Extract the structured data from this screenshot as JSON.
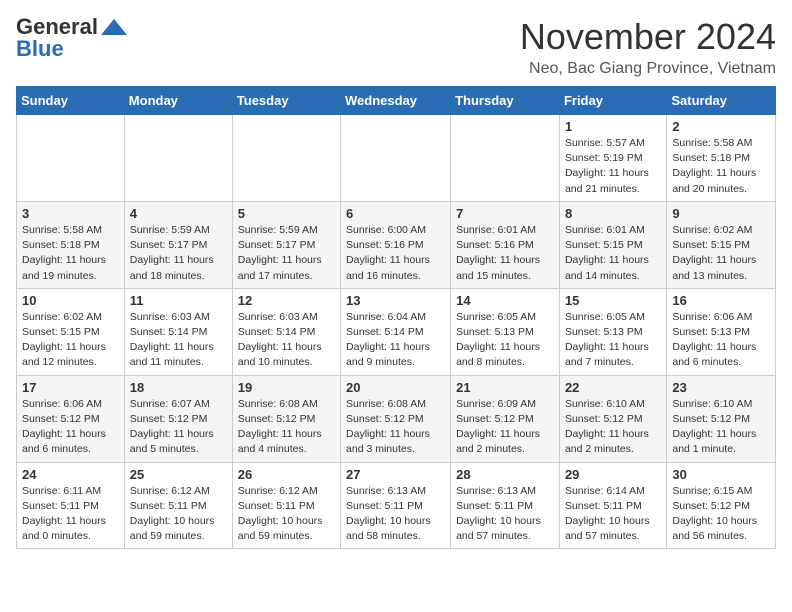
{
  "logo": {
    "general": "General",
    "blue": "Blue"
  },
  "header": {
    "month_year": "November 2024",
    "location": "Neo, Bac Giang Province, Vietnam"
  },
  "weekdays": [
    "Sunday",
    "Monday",
    "Tuesday",
    "Wednesday",
    "Thursday",
    "Friday",
    "Saturday"
  ],
  "weeks": [
    [
      {
        "day": "",
        "info": ""
      },
      {
        "day": "",
        "info": ""
      },
      {
        "day": "",
        "info": ""
      },
      {
        "day": "",
        "info": ""
      },
      {
        "day": "",
        "info": ""
      },
      {
        "day": "1",
        "info": "Sunrise: 5:57 AM\nSunset: 5:19 PM\nDaylight: 11 hours\nand 21 minutes."
      },
      {
        "day": "2",
        "info": "Sunrise: 5:58 AM\nSunset: 5:18 PM\nDaylight: 11 hours\nand 20 minutes."
      }
    ],
    [
      {
        "day": "3",
        "info": "Sunrise: 5:58 AM\nSunset: 5:18 PM\nDaylight: 11 hours\nand 19 minutes."
      },
      {
        "day": "4",
        "info": "Sunrise: 5:59 AM\nSunset: 5:17 PM\nDaylight: 11 hours\nand 18 minutes."
      },
      {
        "day": "5",
        "info": "Sunrise: 5:59 AM\nSunset: 5:17 PM\nDaylight: 11 hours\nand 17 minutes."
      },
      {
        "day": "6",
        "info": "Sunrise: 6:00 AM\nSunset: 5:16 PM\nDaylight: 11 hours\nand 16 minutes."
      },
      {
        "day": "7",
        "info": "Sunrise: 6:01 AM\nSunset: 5:16 PM\nDaylight: 11 hours\nand 15 minutes."
      },
      {
        "day": "8",
        "info": "Sunrise: 6:01 AM\nSunset: 5:15 PM\nDaylight: 11 hours\nand 14 minutes."
      },
      {
        "day": "9",
        "info": "Sunrise: 6:02 AM\nSunset: 5:15 PM\nDaylight: 11 hours\nand 13 minutes."
      }
    ],
    [
      {
        "day": "10",
        "info": "Sunrise: 6:02 AM\nSunset: 5:15 PM\nDaylight: 11 hours\nand 12 minutes."
      },
      {
        "day": "11",
        "info": "Sunrise: 6:03 AM\nSunset: 5:14 PM\nDaylight: 11 hours\nand 11 minutes."
      },
      {
        "day": "12",
        "info": "Sunrise: 6:03 AM\nSunset: 5:14 PM\nDaylight: 11 hours\nand 10 minutes."
      },
      {
        "day": "13",
        "info": "Sunrise: 6:04 AM\nSunset: 5:14 PM\nDaylight: 11 hours\nand 9 minutes."
      },
      {
        "day": "14",
        "info": "Sunrise: 6:05 AM\nSunset: 5:13 PM\nDaylight: 11 hours\nand 8 minutes."
      },
      {
        "day": "15",
        "info": "Sunrise: 6:05 AM\nSunset: 5:13 PM\nDaylight: 11 hours\nand 7 minutes."
      },
      {
        "day": "16",
        "info": "Sunrise: 6:06 AM\nSunset: 5:13 PM\nDaylight: 11 hours\nand 6 minutes."
      }
    ],
    [
      {
        "day": "17",
        "info": "Sunrise: 6:06 AM\nSunset: 5:12 PM\nDaylight: 11 hours\nand 6 minutes."
      },
      {
        "day": "18",
        "info": "Sunrise: 6:07 AM\nSunset: 5:12 PM\nDaylight: 11 hours\nand 5 minutes."
      },
      {
        "day": "19",
        "info": "Sunrise: 6:08 AM\nSunset: 5:12 PM\nDaylight: 11 hours\nand 4 minutes."
      },
      {
        "day": "20",
        "info": "Sunrise: 6:08 AM\nSunset: 5:12 PM\nDaylight: 11 hours\nand 3 minutes."
      },
      {
        "day": "21",
        "info": "Sunrise: 6:09 AM\nSunset: 5:12 PM\nDaylight: 11 hours\nand 2 minutes."
      },
      {
        "day": "22",
        "info": "Sunrise: 6:10 AM\nSunset: 5:12 PM\nDaylight: 11 hours\nand 2 minutes."
      },
      {
        "day": "23",
        "info": "Sunrise: 6:10 AM\nSunset: 5:12 PM\nDaylight: 11 hours\nand 1 minute."
      }
    ],
    [
      {
        "day": "24",
        "info": "Sunrise: 6:11 AM\nSunset: 5:11 PM\nDaylight: 11 hours\nand 0 minutes."
      },
      {
        "day": "25",
        "info": "Sunrise: 6:12 AM\nSunset: 5:11 PM\nDaylight: 10 hours\nand 59 minutes."
      },
      {
        "day": "26",
        "info": "Sunrise: 6:12 AM\nSunset: 5:11 PM\nDaylight: 10 hours\nand 59 minutes."
      },
      {
        "day": "27",
        "info": "Sunrise: 6:13 AM\nSunset: 5:11 PM\nDaylight: 10 hours\nand 58 minutes."
      },
      {
        "day": "28",
        "info": "Sunrise: 6:13 AM\nSunset: 5:11 PM\nDaylight: 10 hours\nand 57 minutes."
      },
      {
        "day": "29",
        "info": "Sunrise: 6:14 AM\nSunset: 5:11 PM\nDaylight: 10 hours\nand 57 minutes."
      },
      {
        "day": "30",
        "info": "Sunrise: 6:15 AM\nSunset: 5:12 PM\nDaylight: 10 hours\nand 56 minutes."
      }
    ]
  ]
}
